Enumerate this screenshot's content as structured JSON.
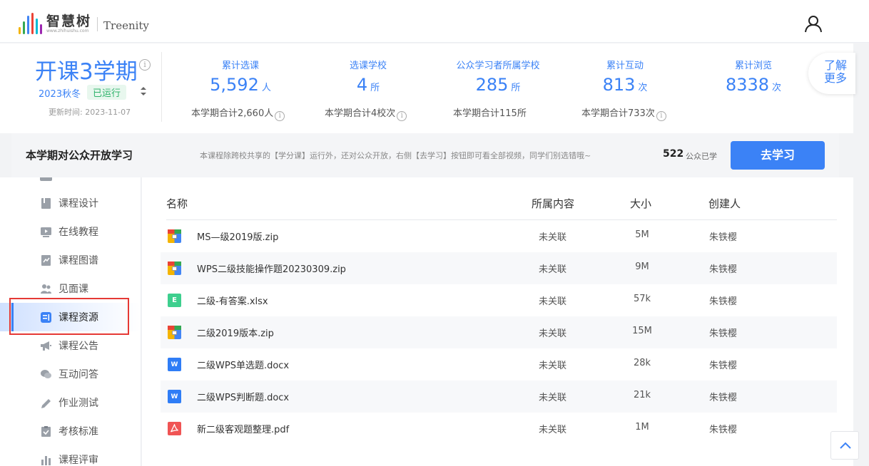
{
  "header": {
    "logo_cn": "智慧树",
    "logo_url": "www.zhihuishu.com",
    "logo_en": "Treenity"
  },
  "term": {
    "title": "开课3学期",
    "semester": "2023秋冬",
    "status": "已运行",
    "updated": "更新时间:  2023-11-07"
  },
  "stats": [
    {
      "label": "累计选课",
      "value": "5,592",
      "unit": "人",
      "sub": "本学期合计2,660人"
    },
    {
      "label": "选课学校",
      "value": "4",
      "unit": "所",
      "sub": "本学期合计4校次"
    },
    {
      "label": "公众学习者所属学校",
      "value": "285",
      "unit": "所",
      "sub": "本学期合计115所"
    },
    {
      "label": "累计互动",
      "value": "813",
      "unit": "次",
      "sub": "本学期合计733次"
    },
    {
      "label": "累计浏览",
      "value": "8338",
      "unit": "次",
      "sub": ""
    }
  ],
  "more_tab": {
    "line1": "了解",
    "line2": "更多"
  },
  "banner": {
    "title": "本学期对公众开放学习",
    "desc": "本课程除跨校共享的【学分课】运行外，还对公众开放，右侧【去学习】按钮即可看全部视频，同学们别选错哦~",
    "count": "522",
    "count_label": "公众已学",
    "button": "去学习"
  },
  "sidebar": {
    "items": [
      {
        "label": "课程设计",
        "icon": "book-icon"
      },
      {
        "label": "在线教程",
        "icon": "video-icon"
      },
      {
        "label": "课程图谱",
        "icon": "graph-icon"
      },
      {
        "label": "见面课",
        "icon": "people-icon"
      },
      {
        "label": "课程资源",
        "icon": "resource-icon",
        "active": true
      },
      {
        "label": "课程公告",
        "icon": "megaphone-icon"
      },
      {
        "label": "互动问答",
        "icon": "chat-icon"
      },
      {
        "label": "作业测试",
        "icon": "pencil-icon"
      },
      {
        "label": "考核标准",
        "icon": "clipboard-icon"
      },
      {
        "label": "课程评审",
        "icon": "chart-icon"
      }
    ]
  },
  "table": {
    "headers": {
      "name": "名称",
      "content": "所属内容",
      "size": "大小",
      "owner": "创建人"
    },
    "rows": [
      {
        "name": "MS—级2019版.zip",
        "type": "zip",
        "content": "未关联",
        "size": "5M",
        "owner": "朱铁樱"
      },
      {
        "name": "WPS二级技能操作题20230309.zip",
        "type": "zip",
        "content": "未关联",
        "size": "9M",
        "owner": "朱铁樱"
      },
      {
        "name": "二级-有答案.xlsx",
        "type": "xlsx",
        "content": "未关联",
        "size": "57k",
        "owner": "朱铁樱"
      },
      {
        "name": "二级2019版本.zip",
        "type": "zip",
        "content": "未关联",
        "size": "15M",
        "owner": "朱铁樱"
      },
      {
        "name": "二级WPS单选题.docx",
        "type": "docx",
        "content": "未关联",
        "size": "28k",
        "owner": "朱铁樱"
      },
      {
        "name": "二级WPS判断题.docx",
        "type": "docx",
        "content": "未关联",
        "size": "21k",
        "owner": "朱铁樱"
      },
      {
        "name": "新二级客观题整理.pdf",
        "type": "pdf",
        "content": "未关联",
        "size": "1M",
        "owner": "朱铁樱"
      }
    ]
  },
  "colors": {
    "accent": "#3b82f6",
    "success": "#2fb36b",
    "highlight": "#e53935"
  }
}
